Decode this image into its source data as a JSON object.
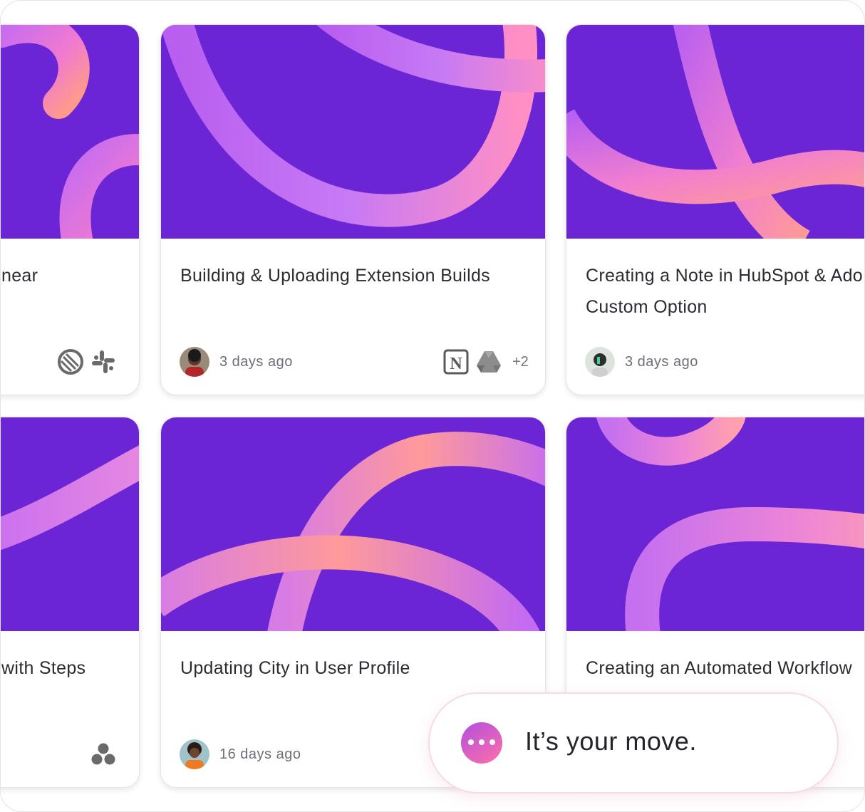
{
  "cards": [
    {
      "title": "near",
      "time": ""
    },
    {
      "title": "Building & Uploading Extension Builds",
      "time": "3 days ago",
      "more_apps": "+2"
    },
    {
      "title_line1": "Creating a Note in HubSpot & Ado",
      "title_line2": "Custom Option",
      "time": "3 days ago"
    },
    {
      "title": "with Steps",
      "time": ""
    },
    {
      "title": "Updating City in User Profile",
      "time": "16 days ago"
    },
    {
      "title": "Creating an Automated Workflow",
      "time": ""
    }
  ],
  "app_icons": {
    "card1": [
      "linear-icon",
      "slack-icon"
    ],
    "card2": [
      "notion-icon",
      "google-drive-icon"
    ],
    "card4": [
      "asana-icon"
    ]
  },
  "toast": {
    "text": "It’s your move."
  },
  "colors": {
    "cover_purple": "#6b25d4",
    "tube_pink": "#ff7fb4",
    "tube_violet": "#c46bf2",
    "text_dark": "#2b2b33",
    "text_muted": "#6e6e78"
  }
}
